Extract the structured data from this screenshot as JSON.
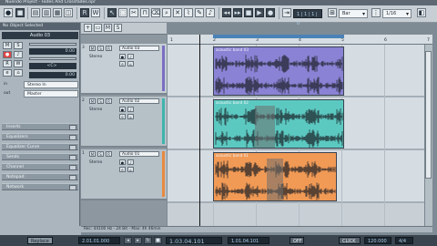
{
  "window": {
    "title": "Nuendo Project - Fades And Crossfades.npr"
  },
  "toolbar": {
    "snap_dropdown": "Bar",
    "quantize_dropdown": "1/16",
    "mode_dropdown": "",
    "position_display": "1 | 1 | 1 | 0"
  },
  "inspector": {
    "no_object": "No Object Selected",
    "track_name": "Audio 03",
    "volume_value": "0.00",
    "pan_value": "<C>",
    "delay_value": "0.00",
    "input_label": "in",
    "input_value": "Stereo In",
    "output_label": "out",
    "output_value": "Master",
    "sections": [
      "Inserts",
      "Equalizers",
      "Equalizer Curve",
      "Sends",
      "Channel",
      "Notepad",
      "Network"
    ]
  },
  "tracks": [
    {
      "num": "3",
      "name": "Audio 03",
      "sub": "Stereo",
      "color": "#7a6fc2"
    },
    {
      "num": "2",
      "name": "Audio 02",
      "sub": "Stereo",
      "color": "#3fb5ad"
    },
    {
      "num": "1",
      "name": "Audio 01",
      "sub": "Stereo",
      "color": "#e98a3f"
    }
  ],
  "ruler": {
    "ticks": [
      "1",
      "2",
      "3",
      "4",
      "5",
      "6",
      "7"
    ]
  },
  "events": [
    {
      "name": "acoustic band 03",
      "color": "#8a82d4"
    },
    {
      "name": "acoustic band 02",
      "color": "#5cc9c1"
    },
    {
      "name": "acoustic band 01",
      "color": "#f19a55"
    }
  ],
  "status": {
    "text": "Rec: 44100 Hz - 24 Bit - Max: 4h 46min"
  },
  "transport": {
    "mode": "Replace",
    "time_left": "2.01.01.000",
    "position_main": "1.03.04.101",
    "position_right": "1.01.04.101",
    "off_label": "OFF",
    "click_label": "CLICK",
    "tempo": "120.000",
    "signature": "4/4"
  }
}
